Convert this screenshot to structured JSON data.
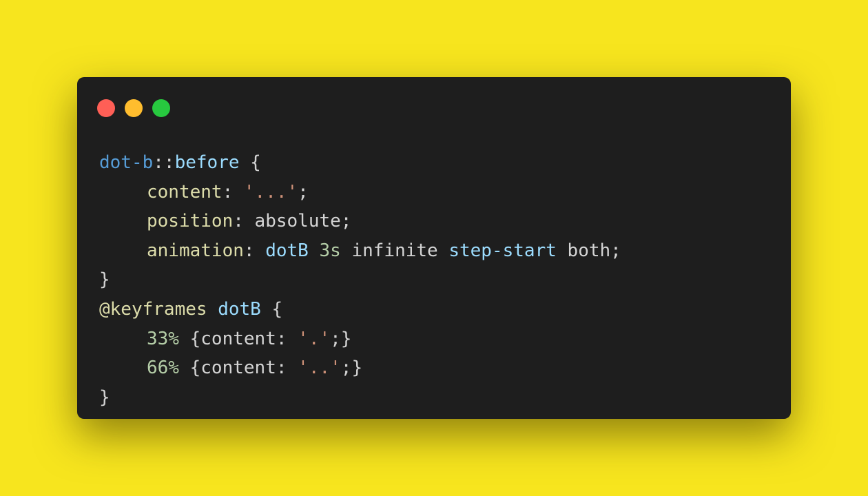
{
  "colors": {
    "background": "#f7e51e",
    "window": "#1e1e1e",
    "close": "#ff5f56",
    "minimize": "#ffbd2e",
    "maximize": "#27c93f"
  },
  "window_controls": [
    "close",
    "minimize",
    "maximize"
  ],
  "code": {
    "l1": {
      "selector": "dot-b",
      "colons": "::",
      "pseudo": "before",
      "brace": " {"
    },
    "l2": {
      "prop": "content",
      "colon": ": ",
      "str": "'...'",
      "semi": ";"
    },
    "l3": {
      "prop": "position",
      "colon": ": ",
      "val": "absolute",
      "semi": ";"
    },
    "l4": {
      "prop": "animation",
      "colon": ": ",
      "name": "dotB",
      "sp1": " ",
      "duration": "3s",
      "sp2": " ",
      "iteration": "infinite",
      "sp3": " ",
      "timing": "step-start",
      "sp4": " ",
      "fill": "both",
      "semi": ";"
    },
    "l5": {
      "brace": "}"
    },
    "l6": {
      "at": "@keyframes",
      "sp": " ",
      "name": "dotB",
      "brace": " {"
    },
    "l7": {
      "pct": "33%",
      "open": " {",
      "prop": "content",
      "colon": ": ",
      "str": "'.'",
      "close": ";}"
    },
    "l8": {
      "pct": "66%",
      "open": " {",
      "prop": "content",
      "colon": ": ",
      "str": "'..'",
      "close": ";}"
    },
    "l9": {
      "brace": "}"
    }
  }
}
